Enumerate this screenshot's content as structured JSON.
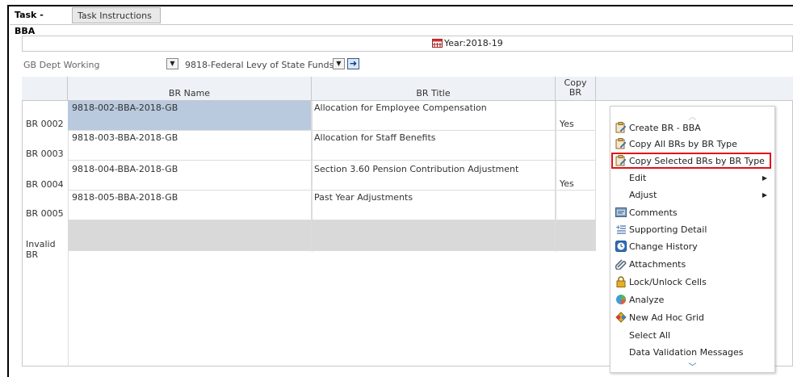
{
  "tabs": {
    "active": "Task - BBA",
    "inactive": "Task Instructions"
  },
  "year": "Year:2018-19",
  "filters": {
    "dept": "GB Dept Working",
    "fund": "9818-Federal Levy of State Funds"
  },
  "columns": {
    "br_name": "BR Name",
    "br_title": "BR Title",
    "copy_br_1": "Copy",
    "copy_br_2": "BR"
  },
  "rows": [
    {
      "label": "BR 0002",
      "name": "9818-002-BBA-2018-GB",
      "title": "Allocation for Employee Compensation",
      "copy": "Yes"
    },
    {
      "label": "BR 0003",
      "name": "9818-003-BBA-2018-GB",
      "title": "Allocation for Staff Benefits",
      "copy": ""
    },
    {
      "label": "BR 0004",
      "name": "9818-004-BBA-2018-GB",
      "title": "Section 3.60 Pension Contribution Adjustment",
      "copy": "Yes"
    },
    {
      "label": "BR 0005",
      "name": "9818-005-BBA-2018-GB",
      "title": "Past Year Adjustments",
      "copy": ""
    },
    {
      "label": "Invalid BR",
      "name": "",
      "title": "",
      "copy": ""
    }
  ],
  "menu": {
    "items": [
      {
        "label": "Create BR - BBA",
        "icon": "doc-edit-icon"
      },
      {
        "label": "Copy All BRs by BR Type",
        "icon": "doc-edit-icon"
      },
      {
        "label": "Copy Selected BRs by BR Type",
        "icon": "doc-edit-icon"
      },
      {
        "label": "Edit",
        "icon": ""
      },
      {
        "label": "Adjust",
        "icon": ""
      },
      {
        "label": "Comments",
        "icon": "comments-icon"
      },
      {
        "label": "Supporting Detail",
        "icon": "supporting-detail-icon"
      },
      {
        "label": "Change History",
        "icon": "change-history-icon"
      },
      {
        "label": "Attachments",
        "icon": "paperclip-icon"
      },
      {
        "label": "Lock/Unlock Cells",
        "icon": "lock-icon"
      },
      {
        "label": "Analyze",
        "icon": "analyze-icon"
      },
      {
        "label": "New Ad Hoc Grid",
        "icon": "ad-hoc-grid-icon"
      },
      {
        "label": "Select All",
        "icon": ""
      },
      {
        "label": "Data Validation Messages",
        "icon": ""
      }
    ]
  },
  "colors": {
    "selected_cell": "#b9c9de",
    "invalid_row": "#d9d9d9",
    "highlight": "#e0101a"
  }
}
